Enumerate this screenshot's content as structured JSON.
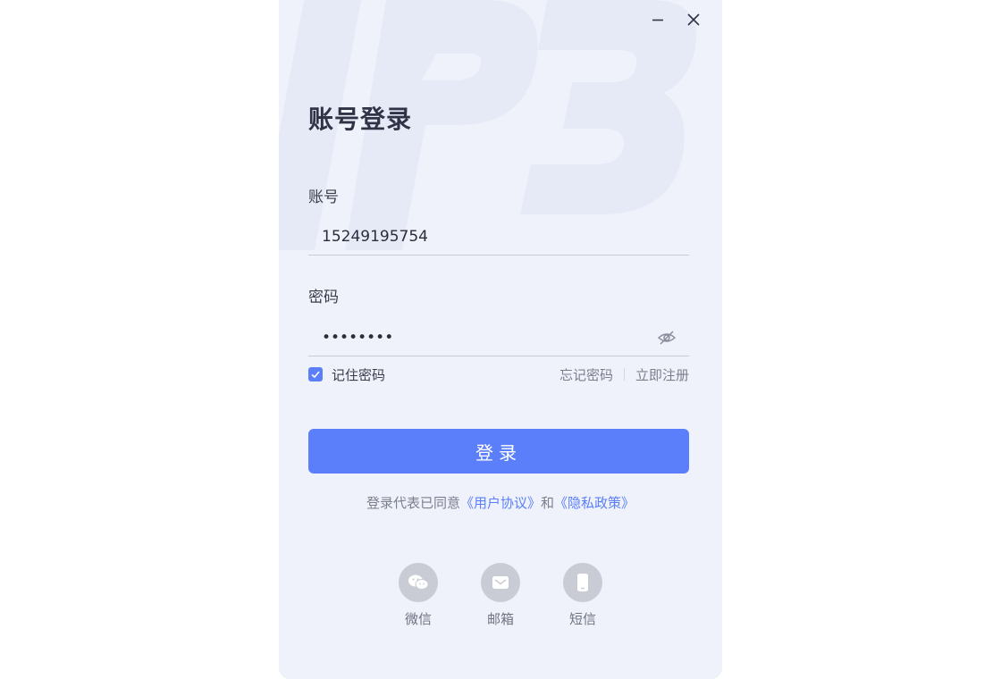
{
  "window": {
    "title": "账号登录"
  },
  "account": {
    "label": "账号",
    "value": "15249195754"
  },
  "password": {
    "label": "密码",
    "value": "password"
  },
  "options": {
    "remember_label": "记住密码",
    "remember_checked": true,
    "forgot_label": "忘记密码",
    "register_label": "立即注册"
  },
  "login_button": {
    "label": "登录"
  },
  "agreement": {
    "prefix": "登录代表已同意",
    "user_agreement": "《用户协议》",
    "conjunction": "和",
    "privacy_policy": "《隐私政策》"
  },
  "social": [
    {
      "label": "微信",
      "icon": "wechat-icon"
    },
    {
      "label": "邮箱",
      "icon": "mail-icon"
    },
    {
      "label": "短信",
      "icon": "phone-icon"
    }
  ],
  "colors": {
    "accent": "#5b7ffa",
    "window_bg": "#eff2fa"
  }
}
